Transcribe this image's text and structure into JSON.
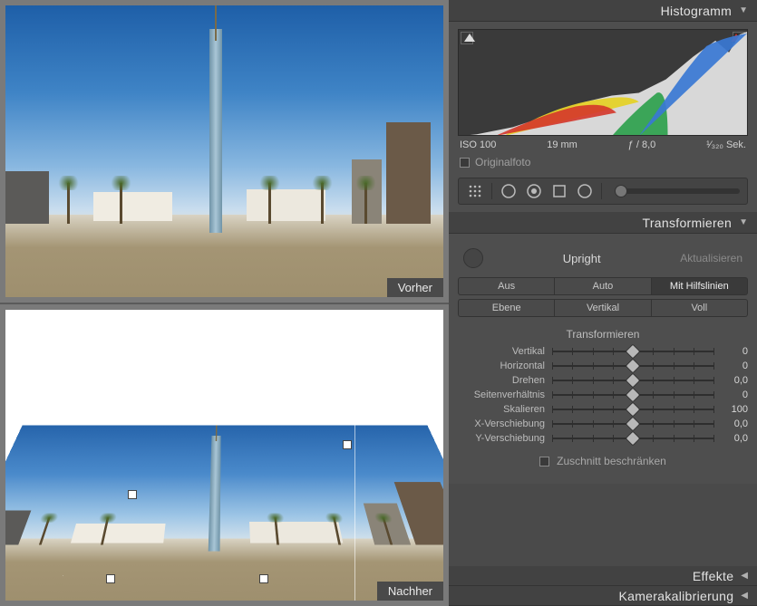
{
  "preview": {
    "before_label": "Vorher",
    "after_label": "Nachher"
  },
  "histogram": {
    "title": "Histogramm",
    "iso": "ISO 100",
    "focal": "19 mm",
    "aperture": "ƒ / 8,0",
    "shutter": "¹⁄₃₂₀ Sek.",
    "original_label": "Originalfoto",
    "original_checked": false
  },
  "transform": {
    "title": "Transformieren",
    "upright_label": "Upright",
    "refresh_label": "Aktualisieren",
    "buttons_row1": [
      "Aus",
      "Auto",
      "Mit Hilfslinien"
    ],
    "buttons_row2": [
      "Ebene",
      "Vertikal",
      "Voll"
    ],
    "active_button": "Mit Hilfslinien",
    "sub_title": "Transformieren",
    "sliders": [
      {
        "label": "Vertikal",
        "value": "0",
        "pos": 50
      },
      {
        "label": "Horizontal",
        "value": "0",
        "pos": 50
      },
      {
        "label": "Drehen",
        "value": "0,0",
        "pos": 50
      },
      {
        "label": "Seitenverhältnis",
        "value": "0",
        "pos": 50
      },
      {
        "label": "Skalieren",
        "value": "100",
        "pos": 50
      },
      {
        "label": "X-Verschiebung",
        "value": "0,0",
        "pos": 50
      },
      {
        "label": "Y-Verschiebung",
        "value": "0,0",
        "pos": 50
      }
    ],
    "constrain_label": "Zuschnitt beschränken",
    "constrain_checked": false
  },
  "effects": {
    "title": "Effekte"
  },
  "calibration": {
    "title": "Kamerakalibrierung"
  }
}
